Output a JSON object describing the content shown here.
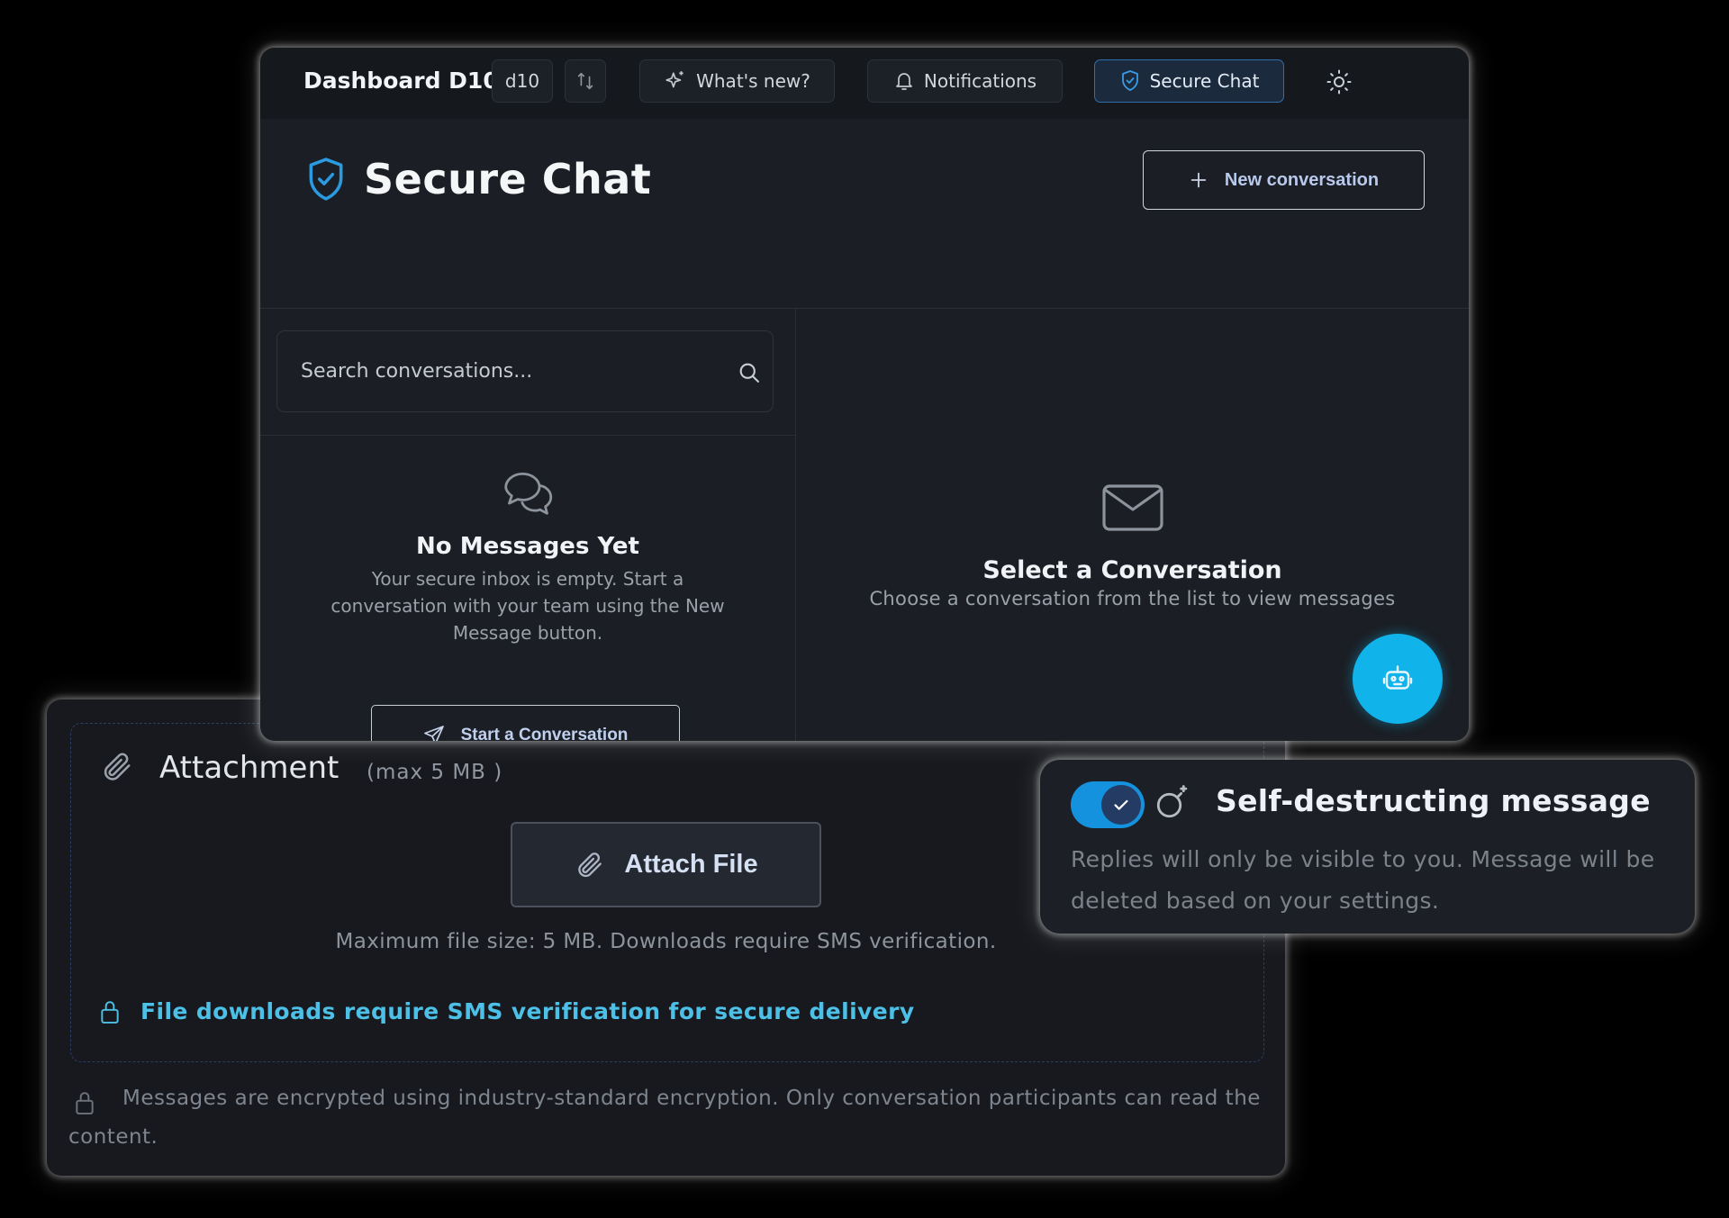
{
  "topbar": {
    "brand": "Dashboard D10",
    "version_chip": "d10",
    "whats_new_label": "What's new?",
    "notifications_label": "Notifications",
    "secure_chat_label": "Secure Chat"
  },
  "page": {
    "title": "Secure Chat",
    "new_conversation_label": "New conversation"
  },
  "search": {
    "placeholder": "Search conversations..."
  },
  "empty_inbox": {
    "title": "No Messages Yet",
    "description": "Your secure inbox is empty. Start a conversation with your team using the New Message button.",
    "start_label": "Start a Conversation"
  },
  "conversation_pane": {
    "title": "Select a Conversation",
    "description": "Choose a conversation from the list to view messages"
  },
  "attachment": {
    "title": "Attachment",
    "max_label": "(max 5 MB )",
    "attach_label": "Attach File",
    "size_note": "Maximum file size: 5 MB. Downloads require SMS verification.",
    "sms_note": "File downloads require SMS verification for secure delivery",
    "encryption_note": "Messages are encrypted using industry-standard encryption. Only conversation participants can read the content."
  },
  "self_destruct": {
    "enabled": true,
    "title": "Self-destructing message",
    "description": "Replies will only be visible to you. Message will be deleted based on your settings."
  },
  "colors": {
    "accent": "#10b4ea",
    "link": "#4cc0e6",
    "toggle_on": "#1592dd",
    "shield": "#2a9be0"
  },
  "icons": [
    "git-compare-icon",
    "sparkles-icon",
    "bell-icon",
    "shield-check-icon",
    "sun-icon",
    "plus-icon",
    "search-icon",
    "messages-icon",
    "send-icon",
    "mail-icon",
    "bot-icon",
    "paperclip-icon",
    "lock-icon",
    "check-icon",
    "bomb-icon"
  ]
}
